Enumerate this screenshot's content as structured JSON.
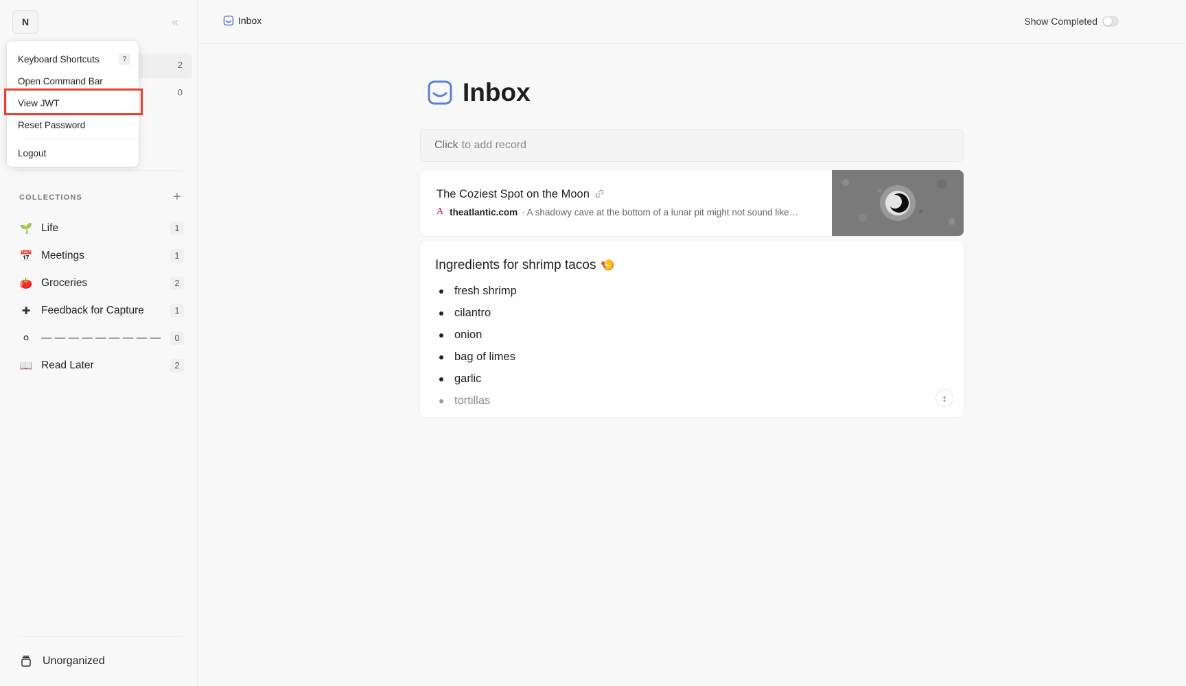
{
  "sidebar": {
    "avatar_initial": "N",
    "collapse_icon": "«",
    "nav_counts": [
      "2",
      "0"
    ],
    "collections_label": "COLLECTIONS",
    "add_icon": "+",
    "collections": [
      {
        "name": "Life",
        "count": "1",
        "icon": "🌱"
      },
      {
        "name": "Meetings",
        "count": "1",
        "icon": "📅"
      },
      {
        "name": "Groceries",
        "count": "2",
        "icon": "🍅"
      },
      {
        "name": "Feedback for Capture",
        "count": "1",
        "icon": "✚"
      },
      {
        "name": "— — — — — — — — —",
        "count": "0",
        "icon": "⚪"
      },
      {
        "name": "Read Later",
        "count": "2",
        "icon": "📖"
      }
    ],
    "unorganized_label": "Unorganized"
  },
  "account_menu": {
    "items": [
      {
        "label": "Keyboard Shortcuts",
        "kbd": "?"
      },
      {
        "label": "Open Command Bar"
      },
      {
        "label": "View JWT"
      },
      {
        "label": "Reset Password"
      },
      {
        "label": "Logout"
      }
    ]
  },
  "topbar": {
    "breadcrumb": "Inbox",
    "show_completed_label": "Show Completed"
  },
  "main": {
    "title": "Inbox",
    "add_record_bold": "Click",
    "add_record_rest": "to add record",
    "link_card": {
      "title": "The Coziest Spot on the Moon",
      "favicon": "A",
      "domain": "theatlantic.com",
      "excerpt": "· A shadowy cave at the bottom of a lunar pit might not sound like…"
    },
    "note_card": {
      "title": "Ingredients for shrimp tacos",
      "emoji": "🍤",
      "items": [
        "fresh shrimp",
        "cilantro",
        "onion",
        "bag of limes",
        "garlic",
        "tortillas"
      ],
      "expand_icon": "↕"
    }
  },
  "colors": {
    "accent": "#5b7fd6",
    "highlight": "#e5412d"
  }
}
